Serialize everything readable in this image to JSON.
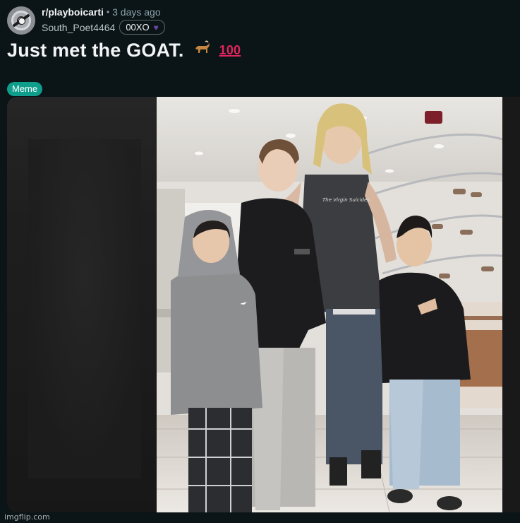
{
  "header": {
    "subreddit": "r/playboicarti",
    "separator": "•",
    "time_ago": "3 days ago",
    "username": "South_Poet4464",
    "user_flair": "00XO",
    "user_flair_icon": "purple-heart-icon"
  },
  "post": {
    "title": "Just met the GOAT.",
    "title_emojis": [
      "goat-icon",
      "hundred-points-icon"
    ],
    "flair": "Meme",
    "flair_color": "#0f9d8c"
  },
  "image": {
    "description_icon": "photo-image",
    "shirt_text": "The Virgin Suicides"
  },
  "watermark": "imgflip.com",
  "colors": {
    "background": "#0b1416",
    "text": "#f2f4f5",
    "muted": "#8ba2ad",
    "flair_green": "#0f9d8c"
  }
}
